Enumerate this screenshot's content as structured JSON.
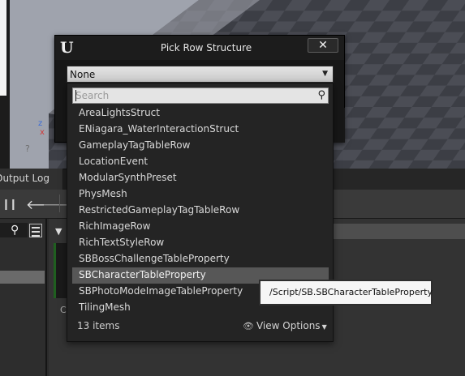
{
  "dialog": {
    "title": "Pick Row Structure",
    "close_label": "✕",
    "logo_text": "U",
    "combo_value": "None"
  },
  "search": {
    "placeholder": "Search"
  },
  "rows": [
    "AreaLightsStruct",
    "ENiagara_WaterInteractionStruct",
    "GameplayTagTableRow",
    "LocationEvent",
    "ModularSynthPreset",
    "PhysMesh",
    "RestrictedGameplayTagTableRow",
    "RichImageRow",
    "RichTextStyleRow",
    "SBBossChallengeTableProperty",
    "SBCharacterTableProperty",
    "SBPhotoModeImageTableProperty",
    "TilingMesh"
  ],
  "selected_index": 10,
  "footer": {
    "items_count": "13 items",
    "view_options": "View Options"
  },
  "tooltip": "/Script/SB.SBCharacterTableProperty",
  "editor": {
    "output_tab": "Output Log",
    "thumb_label": "C",
    "axis_z": "z",
    "axis_x": "x"
  },
  "colors": {
    "selected_row": "#575757",
    "dialog_bg": "#171717",
    "tooltip_bg": "#f6f6f6"
  },
  "icons": [
    "ue-logo",
    "close-icon",
    "dropdown-arrow-icon",
    "search-icon",
    "eye-icon",
    "pause-icon",
    "back-arrow-icon",
    "forward-arrow-icon",
    "filter-icon",
    "list-view-icon"
  ]
}
